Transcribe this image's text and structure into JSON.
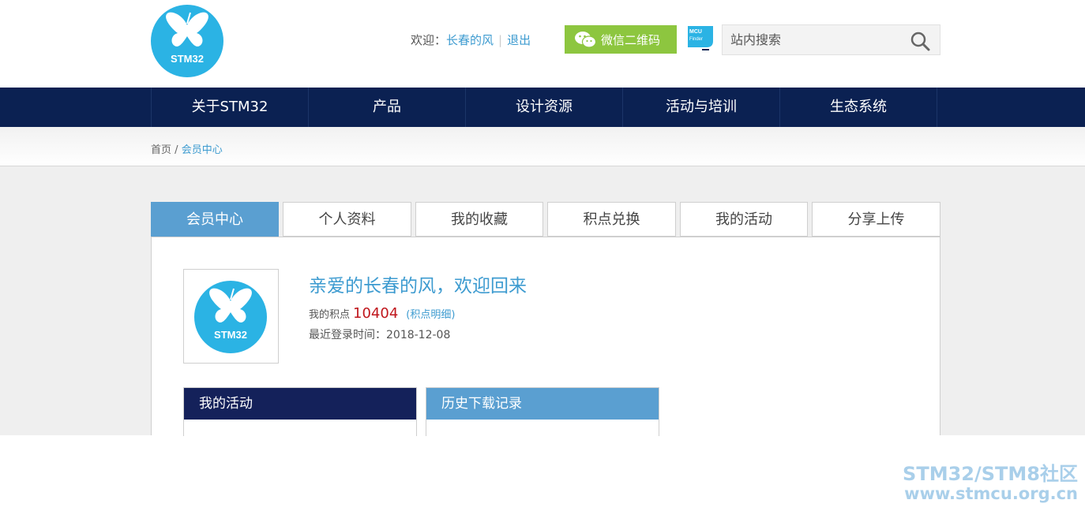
{
  "header": {
    "logo_text": "STM32",
    "welcome_label": "欢迎：",
    "username": "长春的风",
    "logout_label": "退出",
    "wechat_label": "微信二维码",
    "mcu_finder_text_1": "MCU",
    "mcu_finder_text_2": "Finder",
    "search_placeholder": "站内搜索"
  },
  "nav": {
    "items": [
      "关于STM32",
      "产品",
      "设计资源",
      "活动与培训",
      "生态系统"
    ]
  },
  "breadcrumb": {
    "home": "首页",
    "separator": "/",
    "current": "会员中心"
  },
  "tabs": [
    "会员中心",
    "个人资料",
    "我的收藏",
    "积点兑换",
    "我的活动",
    "分享上传"
  ],
  "profile": {
    "avatar_text": "STM32",
    "greeting": "亲爱的长春的风，欢迎回来",
    "points_label": "我的积点",
    "points_value": "10404",
    "points_detail": "(积点明细)",
    "last_login_label": "最近登录时间：",
    "last_login_date": "2018-12-08"
  },
  "sections": {
    "activity_title": "我的活动",
    "downloads_title": "历史下载记录"
  },
  "watermark": {
    "line1": "STM32/STM8社区",
    "line2": "www.stmcu.org.cn"
  },
  "colors": {
    "nav_bg": "#0b2152",
    "accent": "#3d9bd0",
    "tab_active": "#5a9fd1",
    "wechat_green": "#8dc63f",
    "logo_blue": "#2bb3e4",
    "points_red": "#c0161c"
  }
}
